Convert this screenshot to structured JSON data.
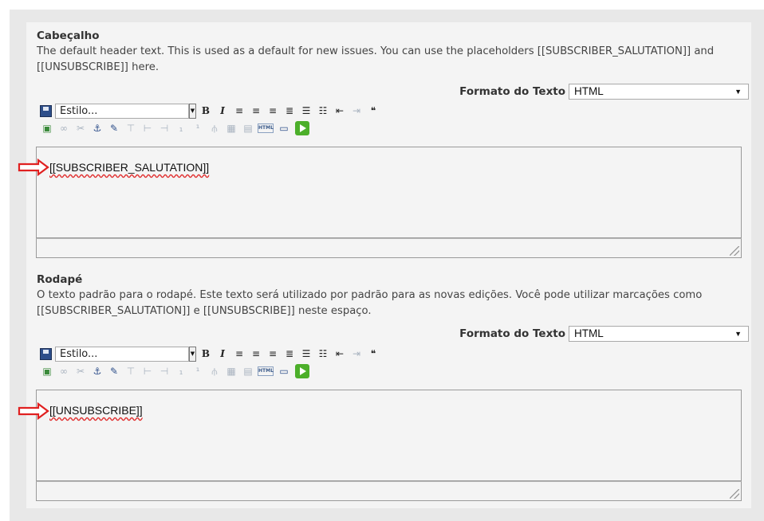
{
  "header_field": {
    "title": "Cabeçalho",
    "description": "The default header text. This is used as a default for new issues. You can use the placeholders [[SUBSCRIBER_SALUTATION]] and [[UNSUBSCRIBE]] here.",
    "format_label": "Formato do Texto",
    "format_value": "HTML",
    "style_placeholder": "Estilo...",
    "editor_content": "[[SUBSCRIBER_SALUTATION]]"
  },
  "footer_field": {
    "title": "Rodapé",
    "description": "O texto padrão para o rodapé. Este texto será utilizado por padrão para as novas edições. Você pode utilizar marcações como [[SUBSCRIBER_SALUTATION]] e [[UNSUBSCRIBE]] neste espaço.",
    "format_label": "Formato do Texto",
    "format_value": "HTML",
    "style_placeholder": "Estilo...",
    "editor_content": "[[UNSUBSCRIBE]]"
  },
  "toolbar": {
    "bold": "B",
    "italic": "I",
    "html_badge": "HTML"
  },
  "colors": {
    "arrow": "#e02020",
    "panel_bg": "#f4f4f4",
    "outer_bg": "#e8e8e8",
    "play": "#4caf2a"
  }
}
